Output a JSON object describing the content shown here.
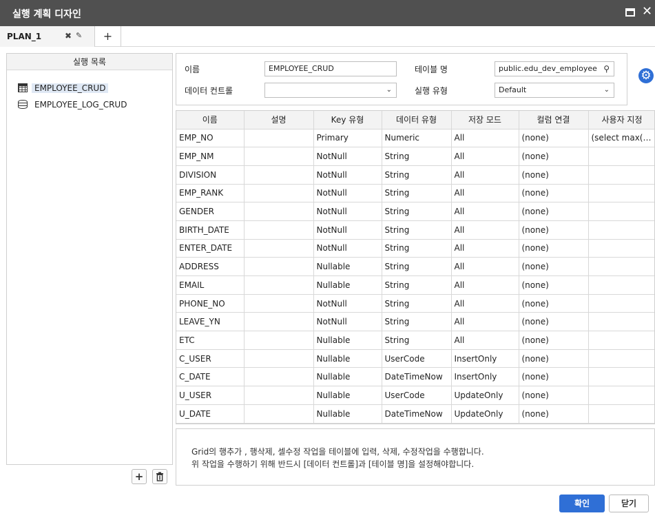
{
  "window": {
    "title": "실행 계획 디자인",
    "maximize_icon": "maximize-icon",
    "close_icon": "close-icon"
  },
  "tabs": [
    {
      "label": "PLAN_1",
      "close_glyph": "✖",
      "edit_glyph": "✎"
    }
  ],
  "add_tab_label": "+",
  "left_panel": {
    "header": "실행 목록",
    "items": [
      {
        "label": "EMPLOYEE_CRUD",
        "icon": "table-icon",
        "selected": true
      },
      {
        "label": "EMPLOYEE_LOG_CRUD",
        "icon": "database-icon",
        "selected": false
      }
    ],
    "add_button": "+",
    "delete_button_icon": "trash-icon"
  },
  "form": {
    "name_label": "이름",
    "name_value": "EMPLOYEE_CRUD",
    "table_label": "테이블 명",
    "table_value": "public.edu_dev_employee",
    "datacontrol_label": "데이터 컨트롤",
    "datacontrol_value": "",
    "exec_type_label": "실행 유형",
    "exec_type_value": "Default"
  },
  "grid": {
    "columns": [
      "이름",
      "설명",
      "Key 유형",
      "데이터 유형",
      "저장 모드",
      "컬럼 연결",
      "사용자 지정"
    ],
    "rows": [
      [
        "EMP_NO",
        "",
        "Primary",
        "Numeric",
        "All",
        "(none)",
        "(select max(e..."
      ],
      [
        "EMP_NM",
        "",
        "NotNull",
        "String",
        "All",
        "(none)",
        ""
      ],
      [
        "DIVISION",
        "",
        "NotNull",
        "String",
        "All",
        "(none)",
        ""
      ],
      [
        "EMP_RANK",
        "",
        "NotNull",
        "String",
        "All",
        "(none)",
        ""
      ],
      [
        "GENDER",
        "",
        "NotNull",
        "String",
        "All",
        "(none)",
        ""
      ],
      [
        "BIRTH_DATE",
        "",
        "NotNull",
        "String",
        "All",
        "(none)",
        ""
      ],
      [
        "ENTER_DATE",
        "",
        "NotNull",
        "String",
        "All",
        "(none)",
        ""
      ],
      [
        "ADDRESS",
        "",
        "Nullable",
        "String",
        "All",
        "(none)",
        ""
      ],
      [
        "EMAIL",
        "",
        "Nullable",
        "String",
        "All",
        "(none)",
        ""
      ],
      [
        "PHONE_NO",
        "",
        "NotNull",
        "String",
        "All",
        "(none)",
        ""
      ],
      [
        "LEAVE_YN",
        "",
        "NotNull",
        "String",
        "All",
        "(none)",
        ""
      ],
      [
        "ETC",
        "",
        "Nullable",
        "String",
        "All",
        "(none)",
        ""
      ],
      [
        "C_USER",
        "",
        "Nullable",
        "UserCode",
        "InsertOnly",
        "(none)",
        ""
      ],
      [
        "C_DATE",
        "",
        "Nullable",
        "DateTimeNow",
        "InsertOnly",
        "(none)",
        ""
      ],
      [
        "U_USER",
        "",
        "Nullable",
        "UserCode",
        "UpdateOnly",
        "(none)",
        ""
      ],
      [
        "U_DATE",
        "",
        "Nullable",
        "DateTimeNow",
        "UpdateOnly",
        "(none)",
        ""
      ]
    ]
  },
  "description": {
    "line1": "Grid의 행추가 , 행삭제, 셀수정 작업을 테이블에 입력, 삭제, 수정작업을 수행합니다.",
    "line2": "위 작업을 수행하기 위해 반드시 [데이터 컨트롤]과 [테이블 명]을 설정해야합니다."
  },
  "buttons": {
    "ok": "확인",
    "close": "닫기"
  },
  "colors": {
    "accent": "#2f6fd6",
    "titlebar": "#505050"
  }
}
